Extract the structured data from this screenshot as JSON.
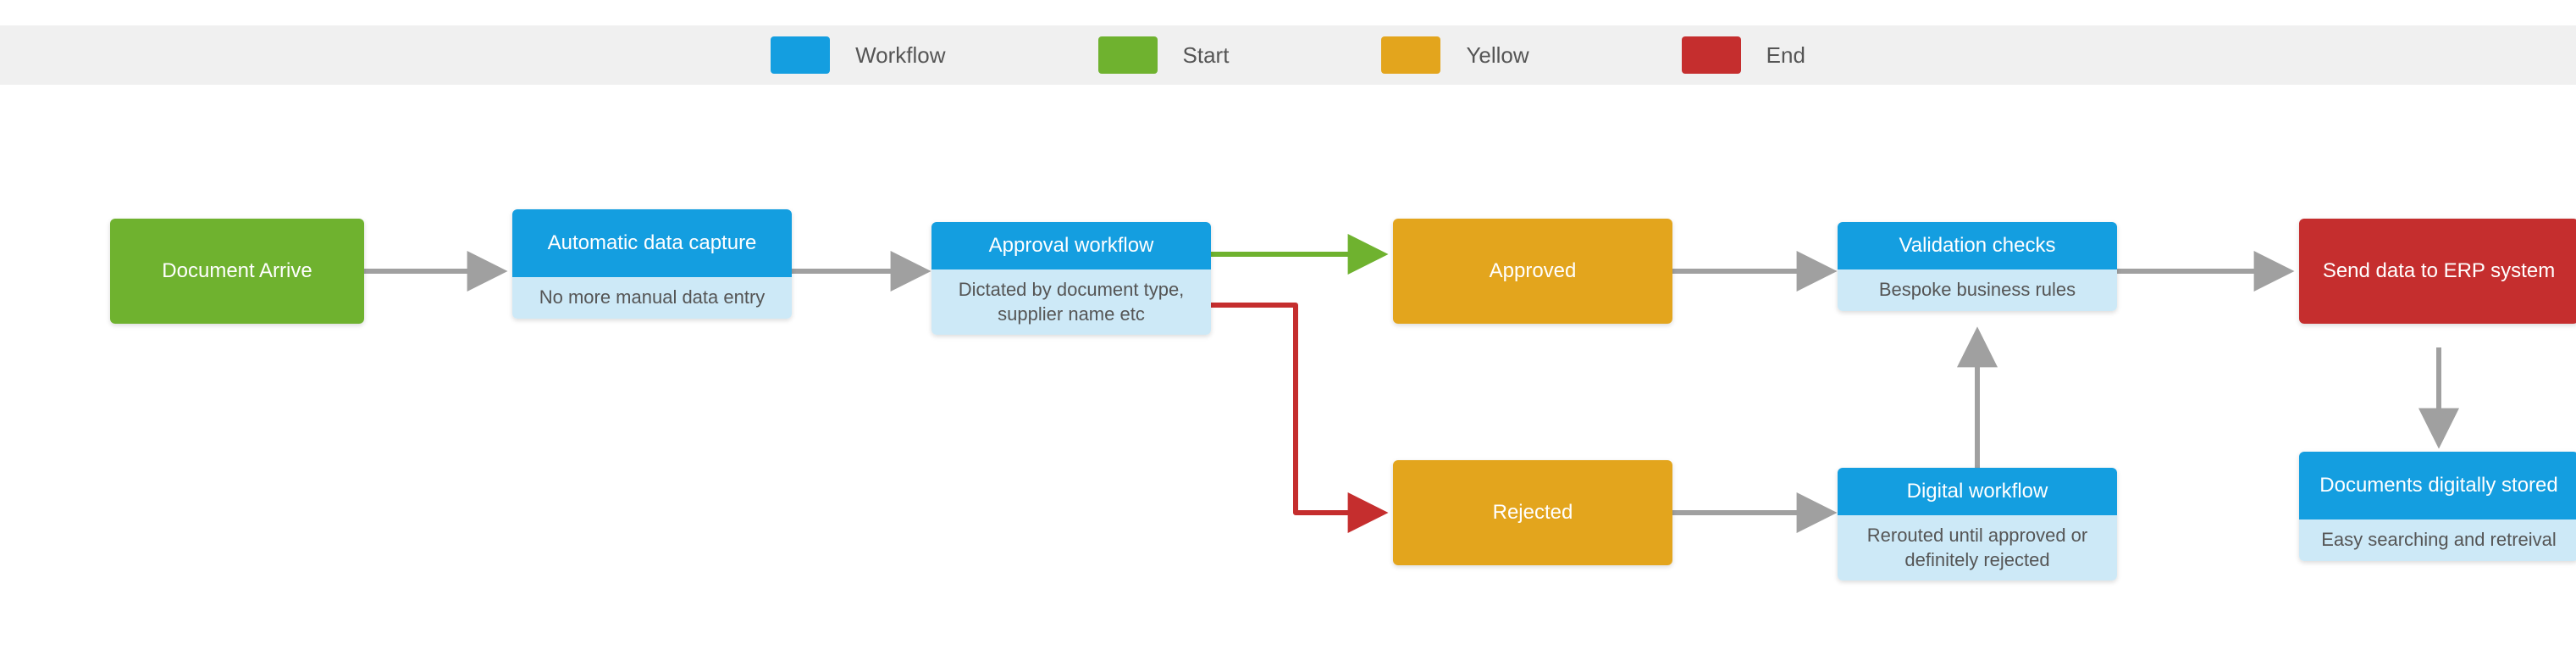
{
  "legend": [
    {
      "label": "Workflow",
      "color": "#149ee0"
    },
    {
      "label": "Start",
      "color": "#6fb22f"
    },
    {
      "label": "Yellow",
      "color": "#e3a51d"
    },
    {
      "label": "End",
      "color": "#c52e2e"
    }
  ],
  "nodes": {
    "start": {
      "title": "Document Arrive",
      "sub": ""
    },
    "capture": {
      "title": "Automatic data capture",
      "sub": "No more manual data entry"
    },
    "approval": {
      "title": "Approval workflow",
      "sub": "Dictated by document type, supplier name etc"
    },
    "approved": {
      "title": "Approved",
      "sub": ""
    },
    "rejected": {
      "title": "Rejected",
      "sub": ""
    },
    "validation": {
      "title": "Validation checks",
      "sub": "Bespoke business rules"
    },
    "digital": {
      "title": "Digital workflow",
      "sub": "Rerouted until approved or definitely rejected"
    },
    "send": {
      "title": "Send data to ERP system",
      "sub": ""
    },
    "stored": {
      "title": "Documents digitally stored",
      "sub": "Easy searching and retreival"
    }
  },
  "colors": {
    "arrow_gray": "#a0a0a0",
    "arrow_green": "#6fb22f",
    "arrow_red": "#c52e2e"
  },
  "chart_data": {
    "type": "flowchart",
    "title": "",
    "nodes": [
      {
        "id": "start",
        "label": "Document Arrive",
        "sub": "",
        "kind": "start",
        "color": "#6fb22f"
      },
      {
        "id": "capture",
        "label": "Automatic data capture",
        "sub": "No more manual data entry",
        "kind": "workflow",
        "color": "#149ee0"
      },
      {
        "id": "approval",
        "label": "Approval workflow",
        "sub": "Dictated by document type, supplier name etc",
        "kind": "workflow",
        "color": "#149ee0"
      },
      {
        "id": "approved",
        "label": "Approved",
        "sub": "",
        "kind": "decision",
        "color": "#e3a51d"
      },
      {
        "id": "rejected",
        "label": "Rejected",
        "sub": "",
        "kind": "decision",
        "color": "#e3a51d"
      },
      {
        "id": "validation",
        "label": "Validation checks",
        "sub": "Bespoke business rules",
        "kind": "workflow",
        "color": "#149ee0"
      },
      {
        "id": "digital",
        "label": "Digital workflow",
        "sub": "Rerouted until approved or definitely rejected",
        "kind": "workflow",
        "color": "#149ee0"
      },
      {
        "id": "send",
        "label": "Send data to ERP system",
        "sub": "",
        "kind": "end",
        "color": "#c52e2e"
      },
      {
        "id": "stored",
        "label": "Documents digitally stored",
        "sub": "Easy searching and retreival",
        "kind": "workflow",
        "color": "#149ee0"
      }
    ],
    "edges": [
      {
        "from": "start",
        "to": "capture",
        "color": "#a0a0a0"
      },
      {
        "from": "capture",
        "to": "approval",
        "color": "#a0a0a0"
      },
      {
        "from": "approval",
        "to": "approved",
        "color": "#6fb22f"
      },
      {
        "from": "approval",
        "to": "rejected",
        "color": "#c52e2e"
      },
      {
        "from": "approved",
        "to": "validation",
        "color": "#a0a0a0"
      },
      {
        "from": "rejected",
        "to": "digital",
        "color": "#a0a0a0"
      },
      {
        "from": "digital",
        "to": "validation",
        "color": "#a0a0a0"
      },
      {
        "from": "validation",
        "to": "send",
        "color": "#a0a0a0"
      },
      {
        "from": "send",
        "to": "stored",
        "color": "#a0a0a0"
      }
    ],
    "legend": [
      {
        "label": "Workflow",
        "color": "#149ee0"
      },
      {
        "label": "Start",
        "color": "#6fb22f"
      },
      {
        "label": "Yellow",
        "color": "#e3a51d"
      },
      {
        "label": "End",
        "color": "#c52e2e"
      }
    ]
  }
}
